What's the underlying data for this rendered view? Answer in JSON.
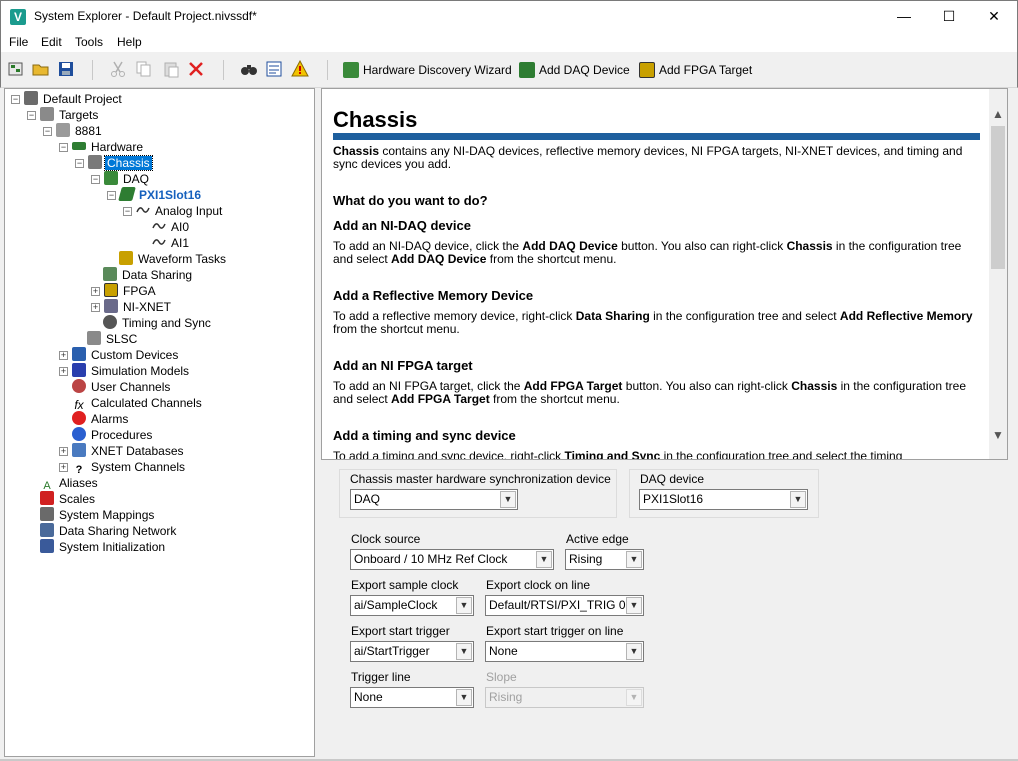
{
  "window": {
    "title": "System Explorer - Default Project.nivssdf*",
    "app_icon_letter": "V",
    "minimize_glyph": "—",
    "maximize_glyph": "☐",
    "close_glyph": "✕"
  },
  "menu": {
    "items": [
      "File",
      "Edit",
      "Tools",
      "Help"
    ]
  },
  "toolbar": {
    "icons": [
      "new-project-icon",
      "open-icon",
      "save-icon",
      "cut-icon",
      "copy-icon",
      "paste-icon",
      "delete-icon",
      "find-icon",
      "properties-icon",
      "warning-icon"
    ],
    "hardware_discovery_label": "Hardware Discovery Wizard",
    "add_daq_label": "Add DAQ Device",
    "add_fpga_label": "Add FPGA Target"
  },
  "tree": {
    "nodes": [
      {
        "label": "Default Project",
        "icon": "project-icon",
        "expander": "−"
      },
      {
        "label": "Targets",
        "icon": "targets-icon",
        "expander": "−"
      },
      {
        "label": "8881",
        "icon": "pxi-controller-icon",
        "expander": "−"
      },
      {
        "label": "Hardware",
        "icon": "hardware-icon",
        "expander": "−"
      },
      {
        "label": "Chassis",
        "icon": "chassis-icon",
        "expander": "−"
      },
      {
        "label": "DAQ",
        "icon": "daq-icon",
        "expander": "−"
      },
      {
        "label": "PXI1Slot16",
        "icon": "daq-device-icon",
        "expander": "−"
      },
      {
        "label": "Analog Input",
        "icon": "analog-input-icon",
        "expander": "−"
      },
      {
        "label": "AI0",
        "icon": "channel-icon",
        "expander": ""
      },
      {
        "label": "AI1",
        "icon": "channel-icon",
        "expander": ""
      },
      {
        "label": "Waveform Tasks",
        "icon": "waveform-tasks-icon",
        "expander": ""
      },
      {
        "label": "Data Sharing",
        "icon": "data-sharing-icon",
        "expander": ""
      },
      {
        "label": "FPGA",
        "icon": "fpga-icon",
        "expander": "+"
      },
      {
        "label": "NI-XNET",
        "icon": "xnet-icon",
        "expander": "+"
      },
      {
        "label": "Timing and Sync",
        "icon": "timing-sync-icon",
        "expander": ""
      },
      {
        "label": "SLSC",
        "icon": "slsc-icon",
        "expander": ""
      },
      {
        "label": "Custom Devices",
        "icon": "custom-devices-icon",
        "expander": "+"
      },
      {
        "label": "Simulation Models",
        "icon": "simulation-models-icon",
        "expander": "+"
      },
      {
        "label": "User Channels",
        "icon": "user-channels-icon",
        "expander": ""
      },
      {
        "label": "Calculated Channels",
        "icon": "calculated-channels-icon",
        "expander": ""
      },
      {
        "label": "Alarms",
        "icon": "alarms-icon",
        "expander": ""
      },
      {
        "label": "Procedures",
        "icon": "procedures-icon",
        "expander": ""
      },
      {
        "label": "XNET Databases",
        "icon": "xnet-databases-icon",
        "expander": "+"
      },
      {
        "label": "System Channels",
        "icon": "system-channels-icon",
        "expander": "+"
      },
      {
        "label": "Aliases",
        "icon": "aliases-icon",
        "expander": ""
      },
      {
        "label": "Scales",
        "icon": "scales-icon",
        "expander": ""
      },
      {
        "label": "System Mappings",
        "icon": "system-mappings-icon",
        "expander": ""
      },
      {
        "label": "Data Sharing Network",
        "icon": "data-sharing-network-icon",
        "expander": ""
      },
      {
        "label": "System Initialization",
        "icon": "system-initialization-icon",
        "expander": ""
      }
    ]
  },
  "doc": {
    "title": "Chassis",
    "intro": [
      "Chassis",
      " contains any NI-DAQ devices, reflective memory devices, NI FPGA targets, NI-XNET devices, and timing and sync devices you add."
    ],
    "what_heading": "What do you want to do?",
    "sections": [
      {
        "heading": "Add an NI-DAQ device",
        "parts": [
          "To add an NI-DAQ device, click the ",
          "Add DAQ Device",
          " button. You also can right-click ",
          "Chassis",
          " in the configuration tree and select ",
          "Add DAQ Device",
          " from the shortcut menu."
        ]
      },
      {
        "heading": "Add a Reflective Memory Device",
        "parts": [
          "To add a reflective memory device, right-click ",
          "Data Sharing",
          " in the configuration tree and select ",
          "Add Reflective Memory",
          " from the shortcut menu."
        ]
      },
      {
        "heading": "Add an NI FPGA target",
        "parts": [
          "To add an NI FPGA target, click the ",
          "Add FPGA Target",
          " button. You also can right-click ",
          "Chassis",
          " in the configuration tree and select ",
          "Add FPGA Target",
          " from the shortcut menu."
        ]
      },
      {
        "heading": "Add a timing and sync device",
        "parts": [
          "To add a timing and sync device, right-click ",
          "Timing and Sync",
          " in the configuration tree and select the timing"
        ]
      }
    ],
    "scroll_up_glyph": "▲",
    "scroll_down_glyph": "▼"
  },
  "config": {
    "master_sync_label": "Chassis master hardware synchronization device",
    "master_sync_value": "DAQ",
    "daq_device_label": "DAQ device",
    "daq_device_value": "PXI1Slot16",
    "clock_source_label": "Clock source",
    "clock_source_value": "Onboard / 10 MHz Ref Clock",
    "active_edge_label": "Active edge",
    "active_edge_value": "Rising",
    "export_sample_clock_label": "Export sample clock",
    "export_sample_clock_value": "ai/SampleClock",
    "export_clock_line_label": "Export clock on line",
    "export_clock_line_value": "Default/RTSI/PXI_TRIG 0",
    "export_start_trigger_label": "Export start trigger",
    "export_start_trigger_value": "ai/StartTrigger",
    "export_start_trigger_line_label": "Export start trigger on line",
    "export_start_trigger_line_value": "None",
    "trigger_line_label": "Trigger line",
    "trigger_line_value": "None",
    "slope_label": "Slope",
    "slope_value": "Rising",
    "dropdown_glyph": "▼"
  }
}
